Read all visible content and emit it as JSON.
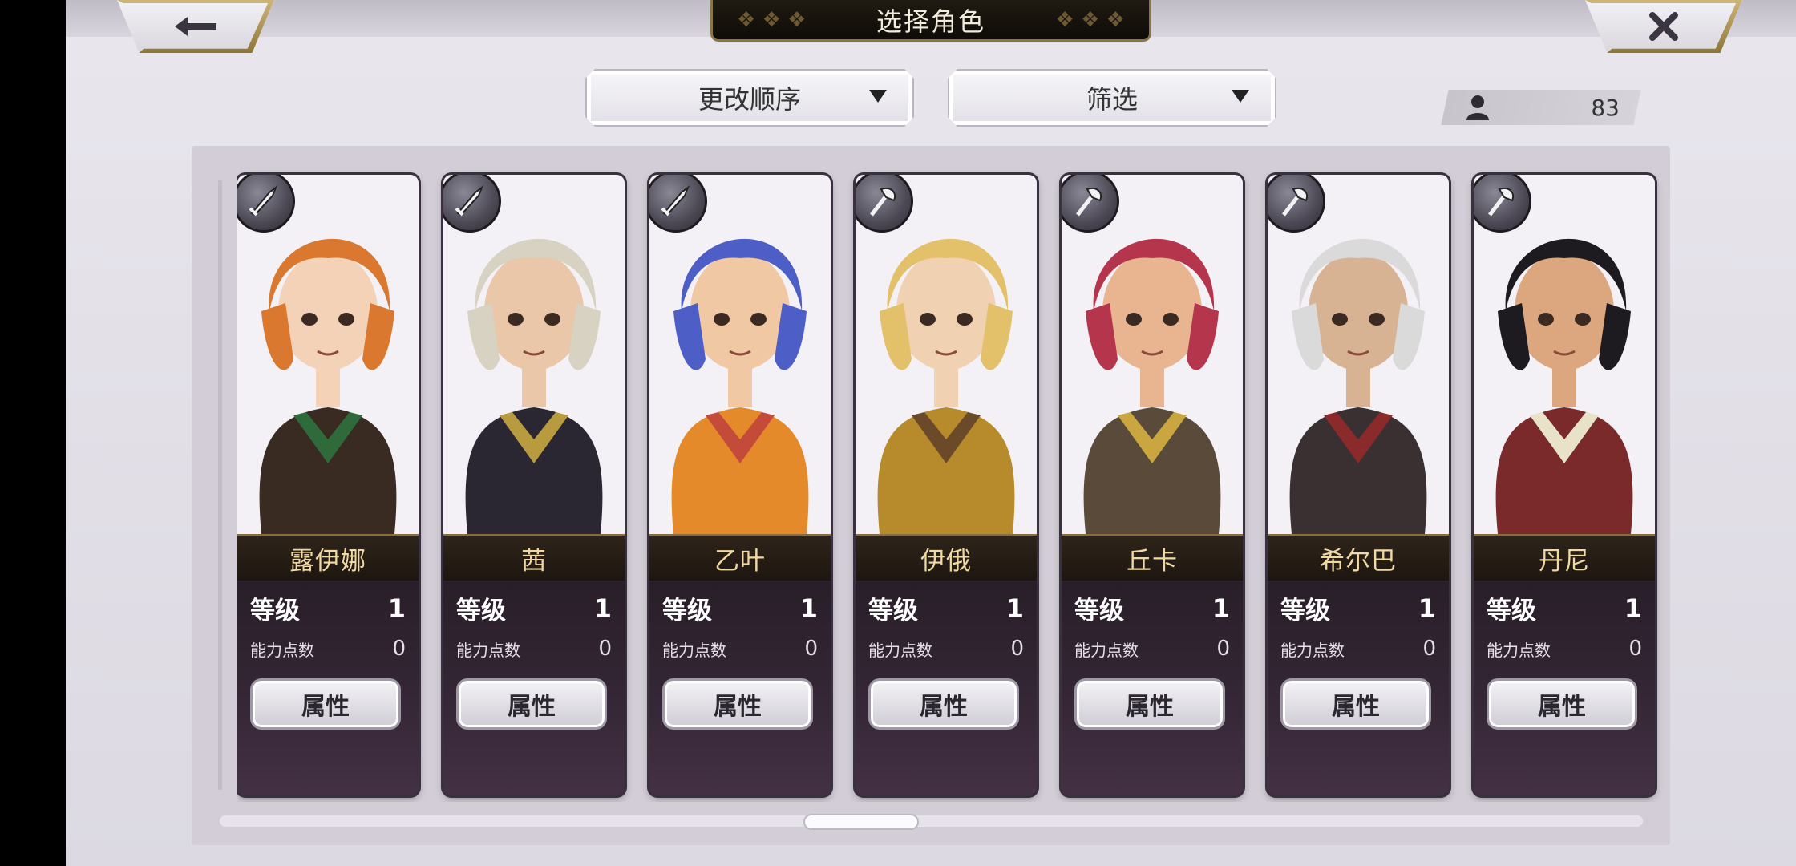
{
  "header": {
    "title": "选择角色",
    "back_icon": "arrow-left-icon",
    "close_icon": "close-icon"
  },
  "controls": {
    "sort_label": "更改顺序",
    "filter_label": "筛选",
    "character_count": "83"
  },
  "stats_labels": {
    "level": "等级",
    "ability_points": "能力点数",
    "attributes_button": "属性"
  },
  "characters": [
    {
      "name": "露伊娜",
      "level": "1",
      "ability_points": "0",
      "weapon": "sword",
      "hair": "#d9782e",
      "skin": "#f3d2b8",
      "outfit": "#3a2b22",
      "accent": "#2f6b3a"
    },
    {
      "name": "茜",
      "level": "1",
      "ability_points": "0",
      "weapon": "sword",
      "hair": "#d8d2c2",
      "skin": "#e9c7a8",
      "outfit": "#2a2733",
      "accent": "#b89b3e"
    },
    {
      "name": "乙叶",
      "level": "1",
      "ability_points": "0",
      "weapon": "sword",
      "hair": "#4d5fc7",
      "skin": "#f0c8a4",
      "outfit": "#e48a2a",
      "accent": "#c44b3a"
    },
    {
      "name": "伊俄",
      "level": "1",
      "ability_points": "0",
      "weapon": "axe",
      "hair": "#e3c06a",
      "skin": "#f0d1b2",
      "outfit": "#b78a2c",
      "accent": "#6b4a2a"
    },
    {
      "name": "丘卡",
      "level": "1",
      "ability_points": "0",
      "weapon": "axe",
      "hair": "#b5354c",
      "skin": "#e9b591",
      "outfit": "#5a4a3a",
      "accent": "#c9a640"
    },
    {
      "name": "希尔巴",
      "level": "1",
      "ability_points": "0",
      "weapon": "axe",
      "hair": "#dadada",
      "skin": "#d8b393",
      "outfit": "#3a3032",
      "accent": "#8a2a2a"
    },
    {
      "name": "丹尼",
      "level": "1",
      "ability_points": "0",
      "weapon": "axe",
      "hair": "#1e1b20",
      "skin": "#dca77f",
      "outfit": "#7a2a2a",
      "accent": "#e8e3c8"
    }
  ]
}
